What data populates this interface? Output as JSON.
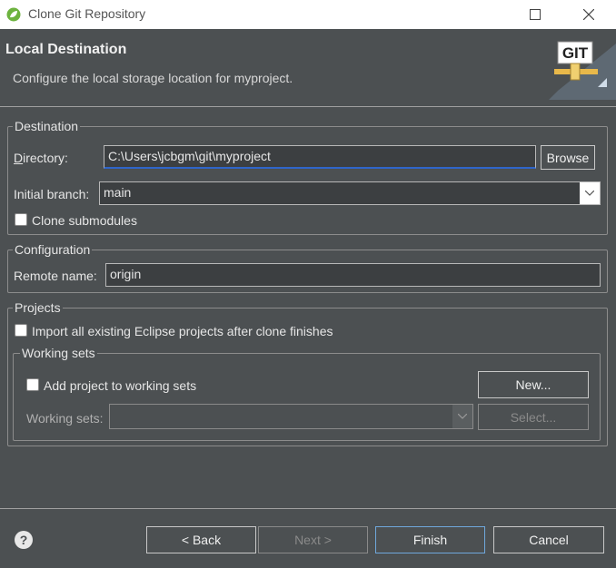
{
  "window": {
    "title": "Clone Git Repository"
  },
  "header": {
    "title": "Local Destination",
    "description": "Configure the local storage location for myproject.",
    "banner_text": "GIT"
  },
  "destination": {
    "legend": "Destination",
    "directory_label": "Directory:",
    "directory_value": "C:\\Users\\jcbgm\\git\\myproject",
    "browse_label": "Browse",
    "branch_label": "Initial branch:",
    "branch_value": "main",
    "submodules_label": "Clone submodules",
    "submodules_checked": false
  },
  "configuration": {
    "legend": "Configuration",
    "remote_label": "Remote name:",
    "remote_value": "origin"
  },
  "projects": {
    "legend": "Projects",
    "import_label": "Import all existing Eclipse projects after clone finishes",
    "import_checked": false,
    "working_sets": {
      "legend": "Working sets",
      "add_label": "Add project to working sets",
      "add_checked": false,
      "new_label": "New...",
      "sets_label": "Working sets:",
      "sets_value": "",
      "select_label": "Select..."
    }
  },
  "footer": {
    "help_icon": "?",
    "back_label": "< Back",
    "next_label": "Next >",
    "finish_label": "Finish",
    "cancel_label": "Cancel"
  }
}
